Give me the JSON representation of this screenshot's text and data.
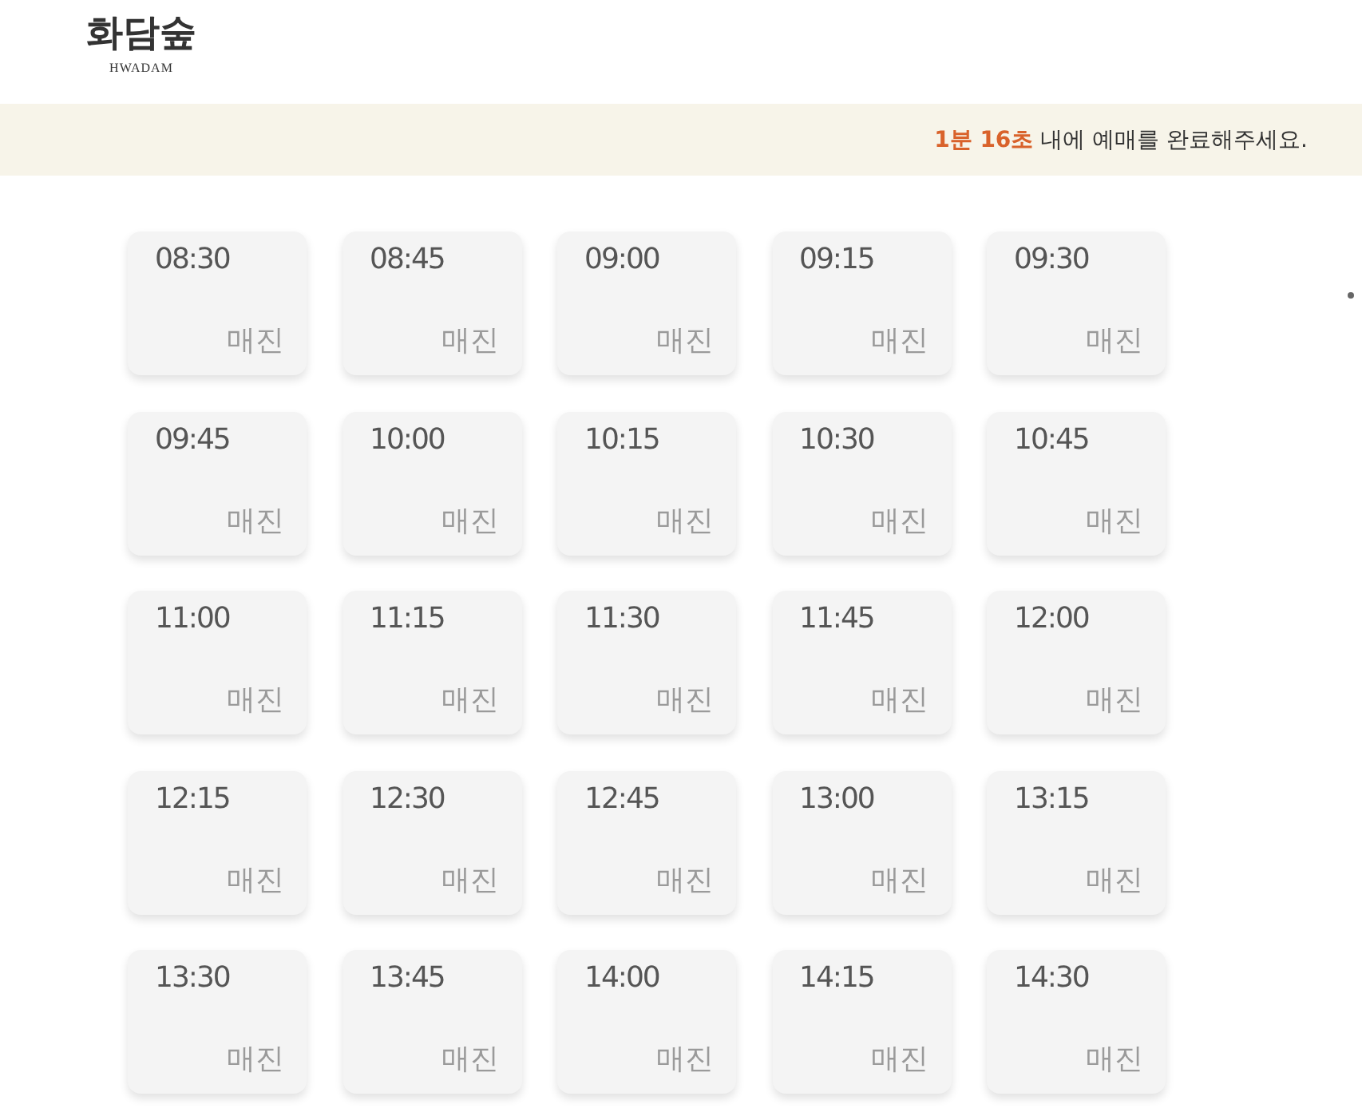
{
  "header": {
    "logo_title": "화담숲",
    "logo_subtitle": "HWADAM"
  },
  "notice": {
    "highlight": "1분 16초",
    "text": "내에 예매를 완료해주세요."
  },
  "slots": [
    {
      "time": "08:30",
      "status": "매진"
    },
    {
      "time": "08:45",
      "status": "매진"
    },
    {
      "time": "09:00",
      "status": "매진"
    },
    {
      "time": "09:15",
      "status": "매진"
    },
    {
      "time": "09:30",
      "status": "매진"
    },
    {
      "time": "09:45",
      "status": "매진"
    },
    {
      "time": "10:00",
      "status": "매진"
    },
    {
      "time": "10:15",
      "status": "매진"
    },
    {
      "time": "10:30",
      "status": "매진"
    },
    {
      "time": "10:45",
      "status": "매진"
    },
    {
      "time": "11:00",
      "status": "매진"
    },
    {
      "time": "11:15",
      "status": "매진"
    },
    {
      "time": "11:30",
      "status": "매진"
    },
    {
      "time": "11:45",
      "status": "매진"
    },
    {
      "time": "12:00",
      "status": "매진"
    },
    {
      "time": "12:15",
      "status": "매진"
    },
    {
      "time": "12:30",
      "status": "매진"
    },
    {
      "time": "12:45",
      "status": "매진"
    },
    {
      "time": "13:00",
      "status": "매진"
    },
    {
      "time": "13:15",
      "status": "매진"
    },
    {
      "time": "13:30",
      "status": "매진"
    },
    {
      "time": "13:45",
      "status": "매진"
    },
    {
      "time": "14:00",
      "status": "매진"
    },
    {
      "time": "14:15",
      "status": "매진"
    },
    {
      "time": "14:30",
      "status": "매진"
    }
  ]
}
